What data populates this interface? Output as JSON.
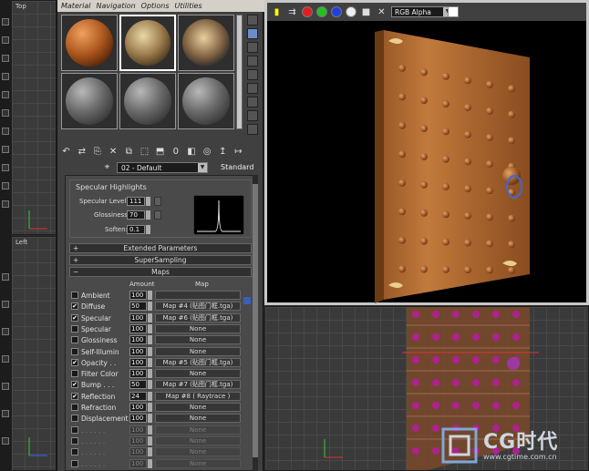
{
  "viewports": {
    "top_label": "Top",
    "left_label": "Left"
  },
  "material_editor": {
    "menu": [
      "Material",
      "Navigation",
      "Options",
      "Utilities"
    ],
    "material_name": "02 - Default",
    "material_type": "Standard",
    "specular_highlights": {
      "title": "Specular Highlights",
      "specular_level_label": "Specular Level:",
      "specular_level": "111",
      "glossiness_label": "Glossiness:",
      "glossiness": "70",
      "soften_label": "Soften:",
      "soften": "0.1"
    },
    "rollouts": {
      "extended": "Extended Parameters",
      "supersampling": "SuperSampling",
      "maps": "Maps"
    },
    "maps_header": {
      "amount": "Amount",
      "map": "Map"
    },
    "maps": [
      {
        "name": "Ambient",
        "checked": false,
        "amount": "100",
        "map": ""
      },
      {
        "name": "Diffuse",
        "checked": true,
        "amount": "50",
        "map": "Map #4 (贴图门框.tga)"
      },
      {
        "name": "Specular",
        "checked": true,
        "amount": "100",
        "map": "Map #6 (贴图门框.tga)"
      },
      {
        "name": "Specular",
        "checked": false,
        "amount": "100",
        "map": "None"
      },
      {
        "name": "Glossiness",
        "checked": false,
        "amount": "100",
        "map": "None"
      },
      {
        "name": "Self-Illumin",
        "checked": false,
        "amount": "100",
        "map": "None"
      },
      {
        "name": "Opacity . .",
        "checked": true,
        "amount": "100",
        "map": "Map #5 (贴图门框.tga)"
      },
      {
        "name": "Filter Color",
        "checked": false,
        "amount": "100",
        "map": "None"
      },
      {
        "name": "Bump . . .",
        "checked": true,
        "amount": "50",
        "map": "Map #7 (贴图门框.tga)"
      },
      {
        "name": "Reflection",
        "checked": true,
        "amount": "24",
        "map": "Map #8 ( Raytrace )"
      },
      {
        "name": "Refraction",
        "checked": false,
        "amount": "100",
        "map": "None"
      },
      {
        "name": "Displacement",
        "checked": false,
        "amount": "100",
        "map": "None"
      },
      {
        "name": ". . . . . .",
        "checked": false,
        "amount": "100",
        "map": "None"
      },
      {
        "name": ". . . . . .",
        "checked": false,
        "amount": "100",
        "map": "None"
      },
      {
        "name": ". . . . . .",
        "checked": false,
        "amount": "100",
        "map": "None"
      },
      {
        "name": ". . . . . .",
        "checked": false,
        "amount": "100",
        "map": "None"
      }
    ]
  },
  "render_window": {
    "channel": "RGB Alpha",
    "colors": {
      "red": "#e02020",
      "green": "#20c020",
      "blue": "#2040e0"
    }
  },
  "watermark": {
    "logo_text": "CG时代",
    "url": "www.cgtime.com.cn"
  }
}
